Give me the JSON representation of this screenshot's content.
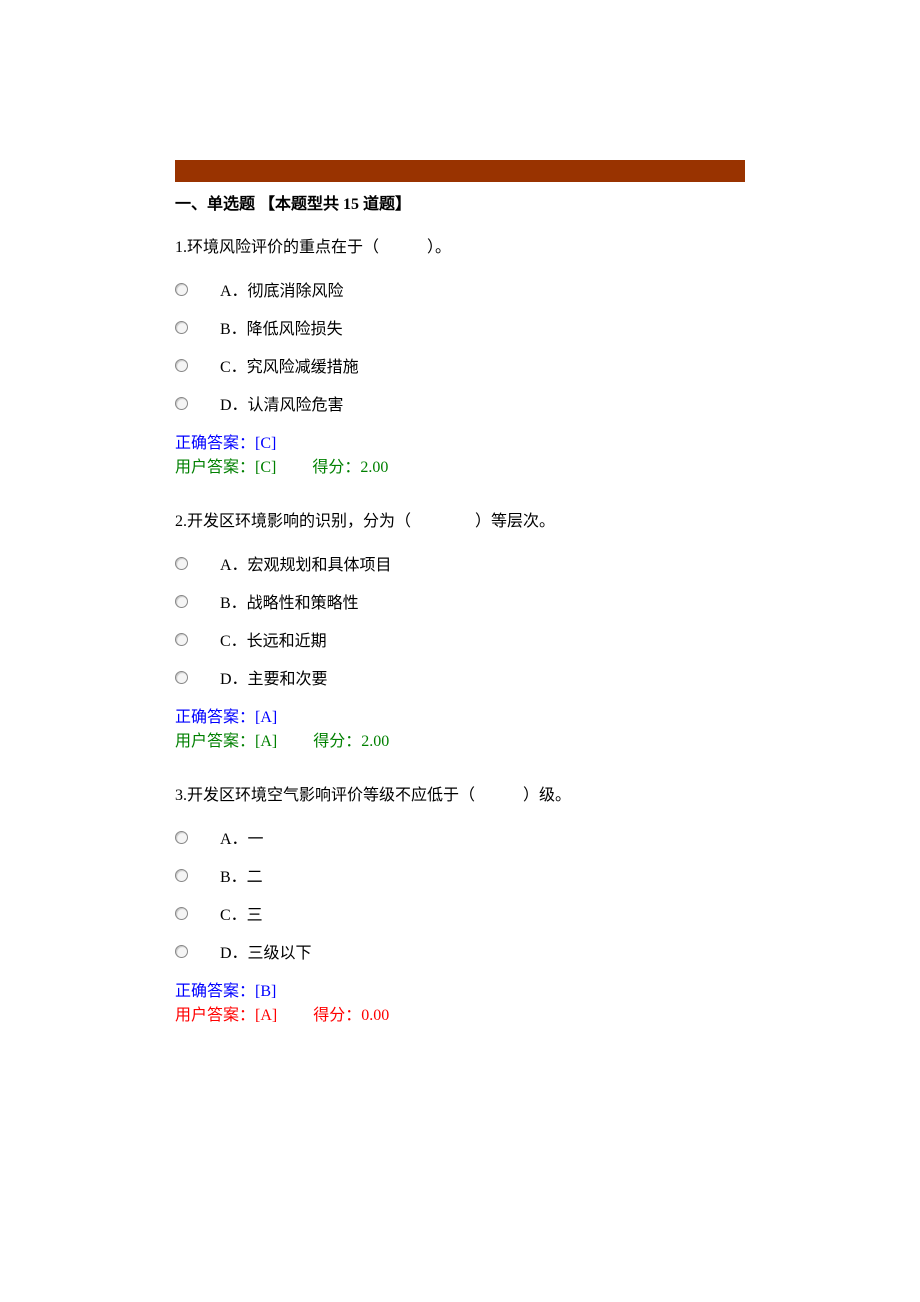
{
  "section_title": "一、单选题 【本题型共 15 道题】",
  "labels": {
    "correct_answer_prefix": "正确答案：",
    "user_answer_prefix": "用户答案：",
    "score_prefix": "得分：",
    "option_prefixes": [
      "A．",
      "B．",
      "C．",
      "D．"
    ]
  },
  "questions": [
    {
      "number": "1.",
      "text": "环境风险评价的重点在于（　　　）。",
      "options": [
        "彻底消除风险",
        "降低风险损失",
        "究风险减缓措施",
        "认清风险危害"
      ],
      "correct": "[C]",
      "user": "[C]",
      "score": "2.00",
      "correct_match": true
    },
    {
      "number": "2.",
      "text": "开发区环境影响的识别，分为（　　　　）等层次。",
      "options": [
        "宏观规划和具体项目",
        "战略性和策略性",
        "长远和近期",
        "主要和次要"
      ],
      "correct": "[A]",
      "user": "[A]",
      "score": "2.00",
      "correct_match": true
    },
    {
      "number": "3.",
      "text": "开发区环境空气影响评价等级不应低于（　　　）级。",
      "options": [
        "一",
        "二",
        "三",
        "三级以下"
      ],
      "correct": "[B]",
      "user": "[A]",
      "score": "0.00",
      "correct_match": false
    }
  ]
}
